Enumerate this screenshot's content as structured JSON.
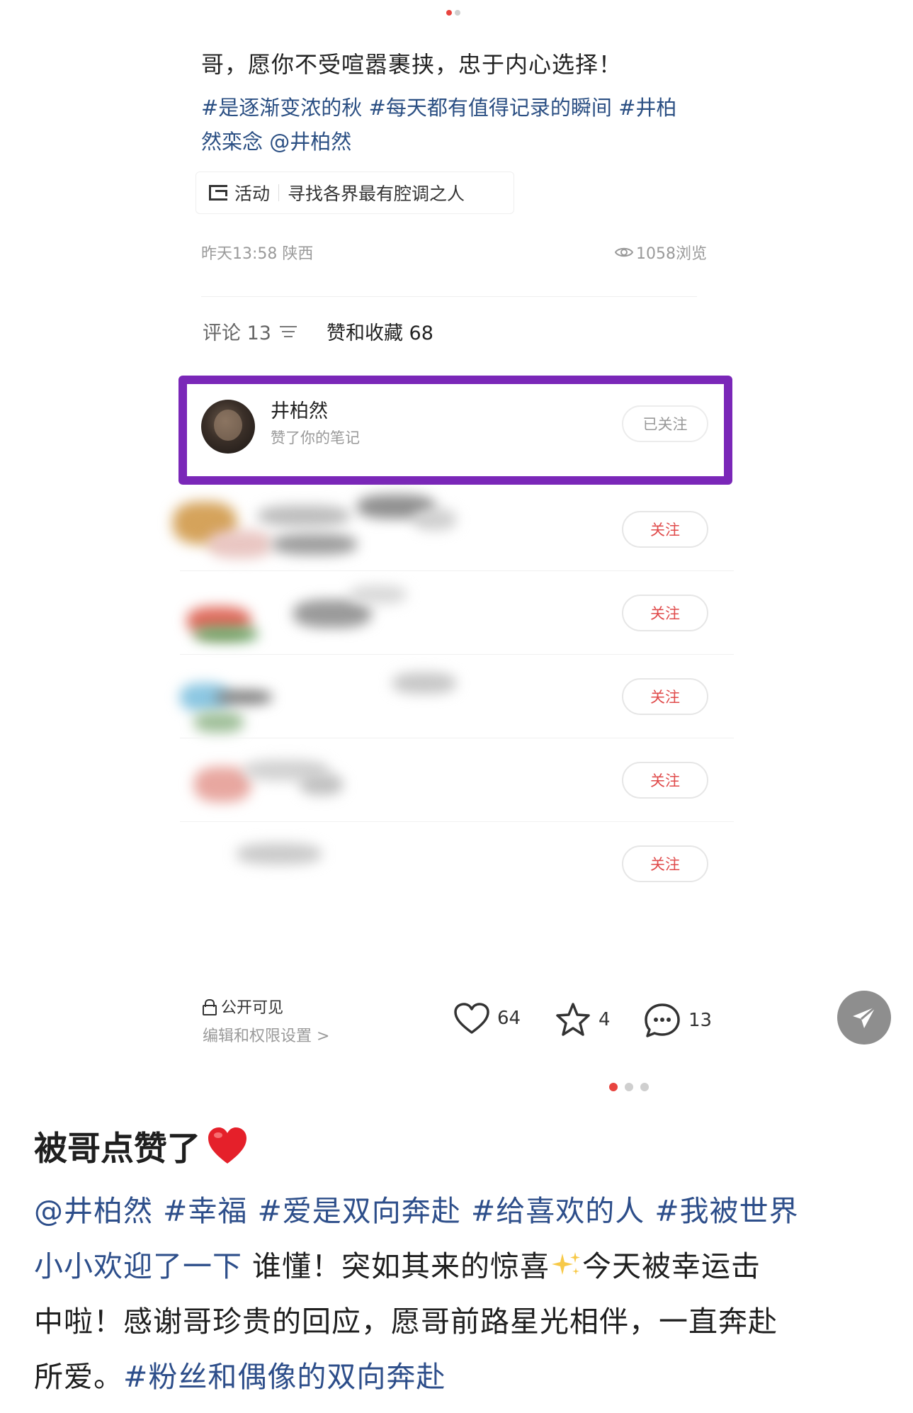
{
  "post": {
    "title": "哥，愿你不受喧嚣裹挟，忠于内心选择！",
    "tags": [
      "#是逐渐变浓的秋",
      "#每天都有值得记录的瞬间",
      "#井柏",
      "然栾念",
      "@井柏然"
    ],
    "activity_label": "活动",
    "activity_text": "寻找各界最有腔调之人",
    "meta": "昨天13:58 陕西",
    "views": "1058浏览"
  },
  "tabs": {
    "comments": "评论 13",
    "likes": "赞和收藏 68"
  },
  "highlight_user": {
    "name": "井柏然",
    "action": "赞了你的笔记",
    "follow_status": "已关注"
  },
  "follow_label": "关注",
  "blurred_user_count": 5,
  "bottom": {
    "visibility": "公开可见",
    "edit_link": "编辑和权限设置 >",
    "likes": "64",
    "favorites": "4",
    "comments": "13"
  },
  "caption": {
    "title": "被哥点赞了",
    "line1": [
      "@井柏然",
      "#幸福",
      "#爱是双向奔赴",
      "#给喜欢的人",
      "#我被世界"
    ],
    "line2_tag": "小小欢迎了一下",
    "line2_text": " 谁懂！突如其来的惊喜",
    "line2_end": "今天被幸运击",
    "line3": "中啦！感谢哥珍贵的回应，愿哥前路星光相伴，一直奔赴",
    "line4_text": "所爱。",
    "line4_tag": "#粉丝和偶像的双向奔赴"
  },
  "colors": {
    "highlight_border": "#7a27b8",
    "follow_text": "#e04b4b",
    "tag_blue": "#2d4e8a",
    "active_dot": "#e8443f"
  }
}
